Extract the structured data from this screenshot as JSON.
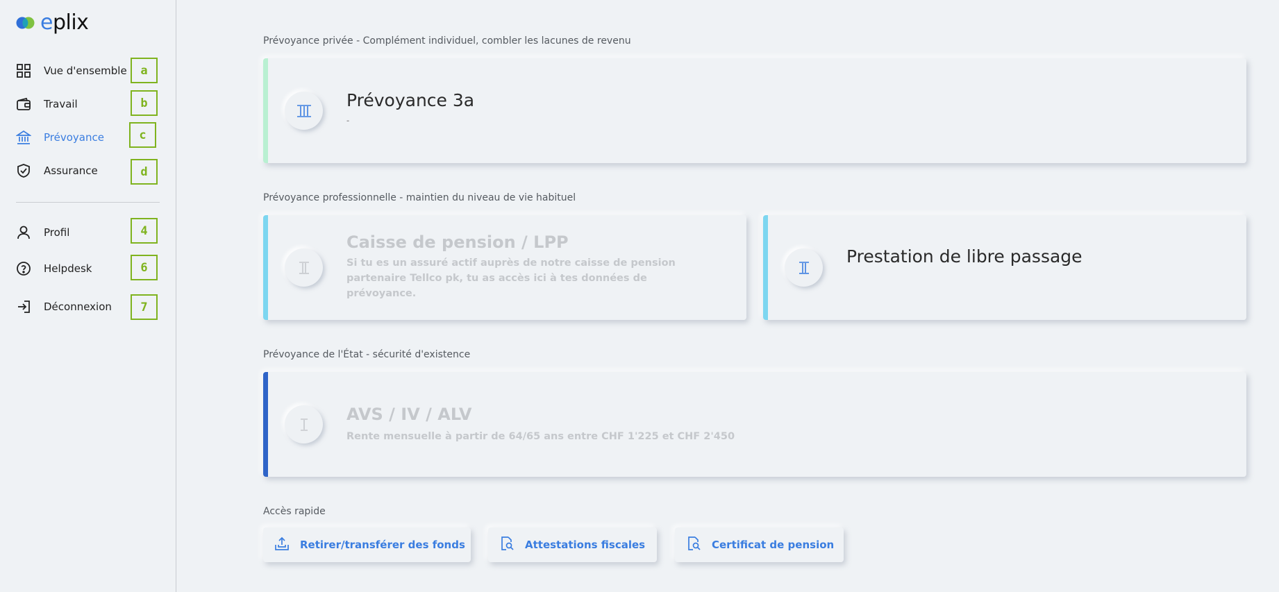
{
  "app": {
    "logo_text": "eplix",
    "brand_color": "#3a7de0",
    "accent_green": "#7fb31e"
  },
  "sidebar": {
    "items": [
      {
        "label": "Vue d'ensemble",
        "icon": "grid-icon",
        "shortcut": "a"
      },
      {
        "label": "Travail",
        "icon": "wallet-icon",
        "shortcut": "b"
      },
      {
        "label": "Prévoyance",
        "icon": "bank-icon",
        "shortcut": "c",
        "active": true
      },
      {
        "label": "Assurance",
        "icon": "shield-check-icon",
        "shortcut": "d"
      },
      {
        "label": "Profil",
        "icon": "user-icon",
        "shortcut": "4"
      },
      {
        "label": "Helpdesk",
        "icon": "help-circle-icon",
        "shortcut": "6"
      },
      {
        "label": "Déconnexion",
        "icon": "logout-icon",
        "shortcut": "7"
      }
    ]
  },
  "main": {
    "private_section_title": "Prévoyance privée - Complément individuel, combler les lacunes de revenu",
    "professional_section_title": "Prévoyance professionnelle - maintien du niveau de vie habituel",
    "state_section_title": "Prévoyance de l'État - sécurité d'existence",
    "quick_access_title": "Accès rapide",
    "cards": {
      "pillar3a": {
        "title": "Prévoyance 3a",
        "subtitle": "-",
        "pillar": "III",
        "stripe_color": "#b9f0d2"
      },
      "lpp": {
        "title": "Caisse de pension / LPP",
        "description": "Si tu es un assuré actif auprès de notre caisse de pension partenaire Tellco pk, tu as accès ici à tes données de prévoyance.",
        "pillar": "II",
        "stripe_color": "#7dd6f0"
      },
      "libre_passage": {
        "title": "Prestation de libre passage",
        "pillar": "II",
        "stripe_color": "#7dd6f0"
      },
      "avs": {
        "title": "AVS / IV / ALV",
        "description": "Rente mensuelle à partir de 64/65 ans entre CHF 1'225 et CHF 2'450",
        "pillar": "I",
        "stripe_color": "#2f64c8"
      }
    },
    "quick_actions": [
      {
        "label": "Retirer/transférer des fonds",
        "icon": "upload-tray-icon"
      },
      {
        "label": "Attestations fiscales",
        "icon": "document-search-icon"
      },
      {
        "label": "Certificat de pension",
        "icon": "document-search-icon"
      }
    ]
  }
}
